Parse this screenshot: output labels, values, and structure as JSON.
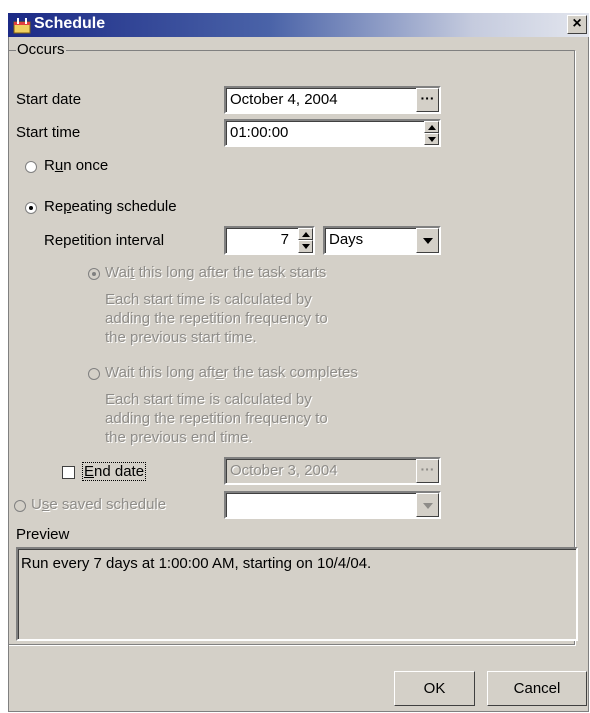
{
  "window": {
    "title": "Schedule",
    "close_label": "×"
  },
  "occurs": {
    "group_label": "Occurs",
    "start_date": {
      "label": "Start date",
      "value": "October 4, 2004",
      "button_label": "···"
    },
    "start_time": {
      "label": "Start time",
      "value": "01:00:00"
    },
    "run_once": {
      "label_pre": "R",
      "label_u": "u",
      "label_post": "n once",
      "selected": false
    },
    "repeating": {
      "label_pre": "Re",
      "label_u": "p",
      "label_post": "eating schedule",
      "selected": true
    },
    "repetition": {
      "label": "Repetition interval",
      "value": "7",
      "unit": "Days"
    },
    "wait_start": {
      "label_pre": "Wai",
      "label_u": "t",
      "label_post": " this long after the task starts",
      "desc": [
        "Each start time is calculated by",
        "adding the repetition frequency to",
        "the previous start time."
      ],
      "selected": true
    },
    "wait_complete": {
      "label_pre": "Wait this long aft",
      "label_u": "e",
      "label_post": "r the task completes",
      "desc": [
        "Each start time is calculated by",
        "adding the repetition frequency to",
        "the previous end time."
      ],
      "selected": false
    },
    "end_date": {
      "label_u": "E",
      "label_post": "nd date",
      "value": "October 3, 2004",
      "checked": false,
      "button_label": "···"
    },
    "saved": {
      "label_pre": "U",
      "label_u": "s",
      "label_post": "e saved schedule",
      "value": ""
    },
    "preview": {
      "label": "Preview",
      "text": "Run every 7 days at 1:00:00 AM, starting on 10/4/04."
    }
  },
  "buttons": {
    "ok": "OK",
    "cancel": "Cancel"
  }
}
